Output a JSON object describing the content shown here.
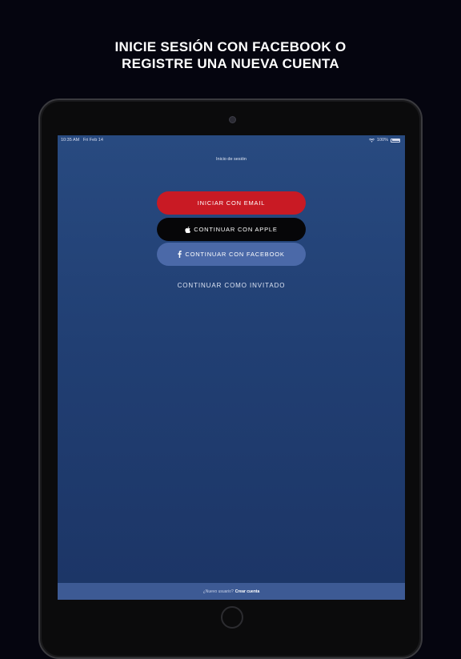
{
  "headline": {
    "line1": "INICIE SESIÓN CON FACEBOOK O",
    "line2": "REGISTRE UNA NUEVA CUENTA"
  },
  "status_bar": {
    "time": "10:35 AM",
    "date": "Fri Feb 14",
    "battery": "100%",
    "icons": [
      "wifi-icon",
      "battery-icon"
    ]
  },
  "screen": {
    "title": "Inicio de sesión",
    "buttons": {
      "email": "INICIAR CON EMAIL",
      "apple": "CONTINUAR CON APPLE",
      "facebook": "CONTINUAR CON FACEBOOK"
    },
    "guest_link": "CONTINUAR COMO INVITADO",
    "footer": {
      "question": "¿Nuevo usuario?",
      "create_link": "Crear cuenta"
    }
  },
  "colors": {
    "email_button": "#c91a24",
    "apple_button": "#060608",
    "facebook_button": "#4b69a8",
    "screen_background": "#213f73",
    "footer_background": "#3d5a94"
  }
}
